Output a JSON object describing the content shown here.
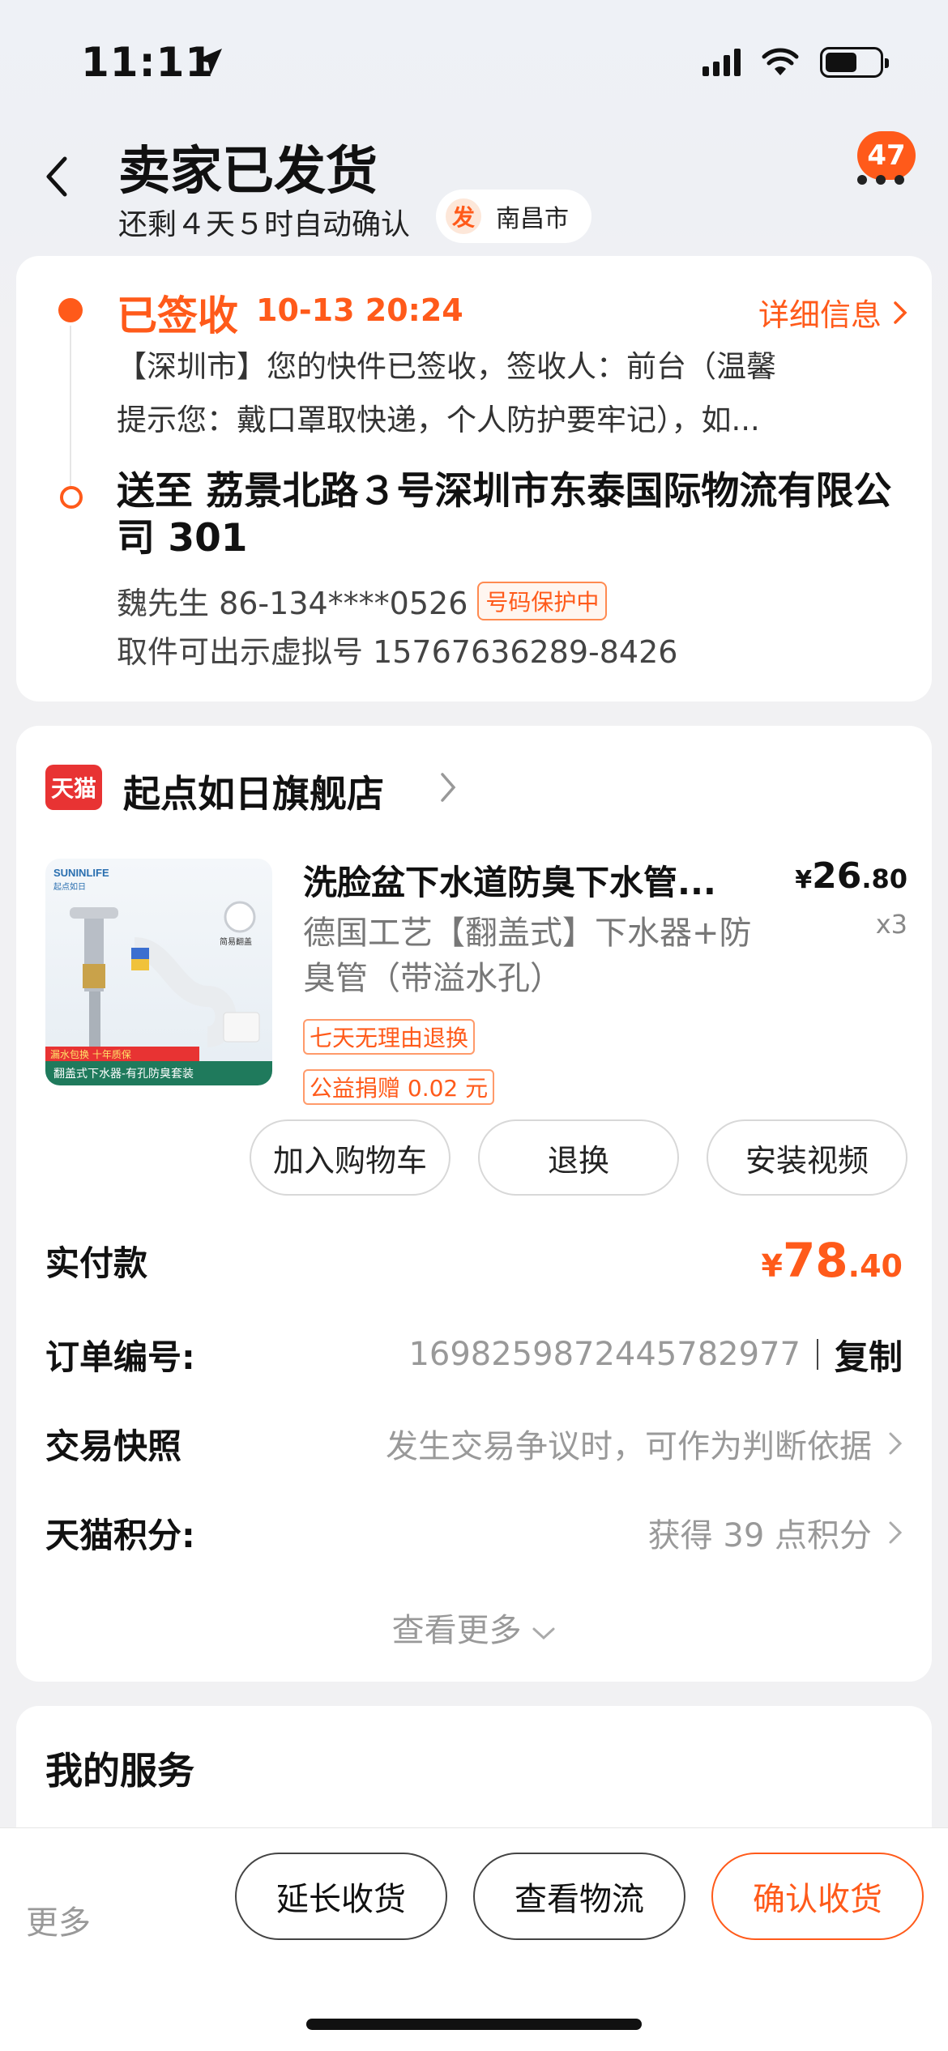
{
  "status_bar": {
    "time": "11:11"
  },
  "header": {
    "title": "卖家已发货",
    "subtitle": "还剩４天５时自动确认",
    "ship_tag": "发",
    "ship_city": "南昌市",
    "message_badge": "47"
  },
  "logistics": {
    "status": "已签收",
    "time": "10-13 20:24",
    "detail_link": "详细信息",
    "text_line1": "【深圳市】您的快件已签收，签收人：前台（温馨",
    "text_line2": "提示您：戴口罩取快递，个人防护要牢记），如...",
    "address": "送至 荔景北路３号深圳市东泰国际物流有限公司 301",
    "receiver": "魏先生 86-134****0526",
    "privacy_tag": "号码保护中",
    "virtual_number": "取件可出示虚拟号 15767636289-8426"
  },
  "shop": {
    "badge": "天猫",
    "name": "起点如日旗舰店"
  },
  "product": {
    "name": "洗脸盆下水道防臭下水管...",
    "spec": "德国工艺【翻盖式】下水器+防臭管（带溢水孔）",
    "price_currency": "¥",
    "price_int": "26",
    "price_dec": ".80",
    "qty": "x3",
    "tag1": "七天无理由退换",
    "tag2": "公益捐赠 0.02 元",
    "img_brand": "SUNINLIFE",
    "img_brand_cn": "起点如日",
    "img_badge": "简易翻盖",
    "img_promo": "漏水包换 十年质保",
    "img_caption": "翻盖式下水器-有孔防臭套装"
  },
  "actions": {
    "add_cart": "加入购物车",
    "return": "退换",
    "install_video": "安装视频"
  },
  "order": {
    "paid_label": "实付款",
    "paid_currency": "¥",
    "paid_int": "78",
    "paid_dec": ".40",
    "order_no_label": "订单编号:",
    "order_no": "1698259872445782977",
    "copy": "复制",
    "snapshot_label": "交易快照",
    "snapshot_value": "发生交易争议时，可作为判断依据",
    "points_label": "天猫积分:",
    "points_value": "获得 39 点积分",
    "see_more": "查看更多"
  },
  "services": {
    "title": "我的服务"
  },
  "bottom": {
    "more": "更多",
    "extend": "延长收货",
    "track": "查看物流",
    "confirm": "确认收货"
  },
  "colors": {
    "accent": "#ff5a1a",
    "tmall_red": "#e83333"
  }
}
